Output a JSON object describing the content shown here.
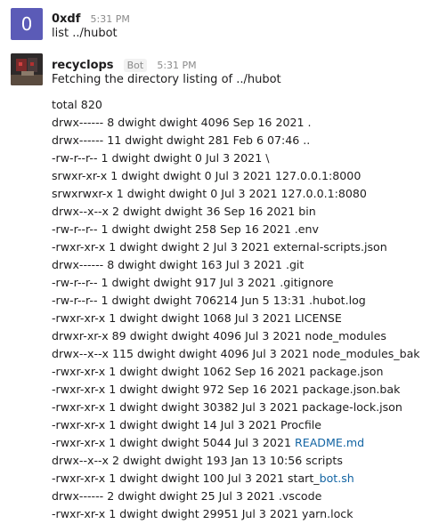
{
  "messages": [
    {
      "avatar_text": "0",
      "username": "0xdf",
      "time": "5:31 PM",
      "text": "list ../hubot"
    },
    {
      "username": "recyclops",
      "bot_label": "Bot",
      "time": "5:31 PM",
      "text": "Fetching the directory listing of ../hubot"
    }
  ],
  "listing": [
    {
      "pre": "total 820"
    },
    {
      "pre": "drwx------ 8 dwight dwight 4096 Sep 16 2021 ."
    },
    {
      "pre": "drwx------ 11 dwight dwight 281 Feb 6 07:46 .."
    },
    {
      "pre": "-rw-r--r-- 1 dwight dwight 0 Jul 3 2021 \\"
    },
    {
      "pre": "srwxr-xr-x 1 dwight dwight 0 Jul 3 2021 127.0.0.1:8000"
    },
    {
      "pre": "srwxrwxr-x 1 dwight dwight 0 Jul 3 2021 127.0.0.1:8080"
    },
    {
      "pre": "drwx--x--x 2 dwight dwight 36 Sep 16 2021 bin"
    },
    {
      "pre": "-rw-r--r-- 1 dwight dwight 258 Sep 16 2021 .env"
    },
    {
      "pre": "-rwxr-xr-x 1 dwight dwight 2 Jul 3 2021 external-scripts.json"
    },
    {
      "pre": "drwx------ 8 dwight dwight 163 Jul 3 2021 .git"
    },
    {
      "pre": "-rw-r--r-- 1 dwight dwight 917 Jul 3 2021 .gitignore"
    },
    {
      "pre": "-rw-r--r-- 1 dwight dwight 706214 Jun 5 13:31 .hubot.log"
    },
    {
      "pre": "-rwxr-xr-x 1 dwight dwight 1068 Jul 3 2021 LICENSE"
    },
    {
      "pre": "drwxr-xr-x 89 dwight dwight 4096 Jul 3 2021 node_modules"
    },
    {
      "pre": "drwx--x--x 115 dwight dwight 4096 Jul 3 2021 node_modules_bak"
    },
    {
      "pre": "-rwxr-xr-x 1 dwight dwight 1062 Sep 16 2021 package.json"
    },
    {
      "pre": "-rwxr-xr-x 1 dwight dwight 972 Sep 16 2021 package.json.bak"
    },
    {
      "pre": "-rwxr-xr-x 1 dwight dwight 30382 Jul 3 2021 package-lock.json"
    },
    {
      "pre": "-rwxr-xr-x 1 dwight dwight 14 Jul 3 2021 Procfile"
    },
    {
      "pre": "-rwxr-xr-x 1 dwight dwight 5044 Jul 3 2021 ",
      "link": "README.md"
    },
    {
      "pre": "drwx--x--x 2 dwight dwight 193 Jan 13 10:56 scripts"
    },
    {
      "pre": "-rwxr-xr-x 1 dwight dwight 100 Jul 3 2021 start_",
      "link": "bot.sh"
    },
    {
      "pre": "drwx------ 2 dwight dwight 25 Jul 3 2021 .vscode"
    },
    {
      "pre": "-rwxr-xr-x 1 dwight dwight 29951 Jul 3 2021 yarn.lock"
    }
  ],
  "colors": {
    "avatar_user": "#5b5bb7",
    "link": "#1264a3",
    "text": "#1d1c1d",
    "muted": "#8a8a8a"
  }
}
